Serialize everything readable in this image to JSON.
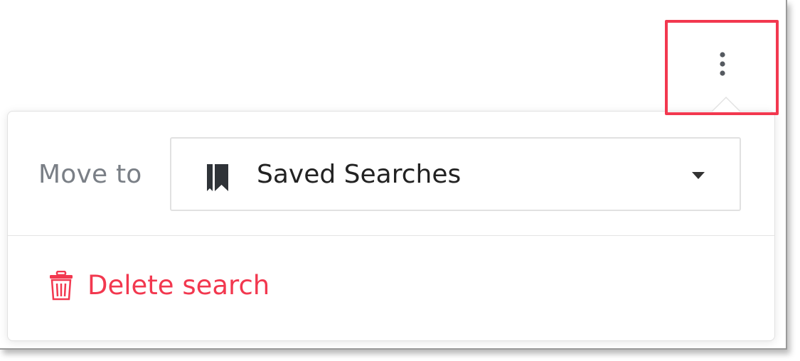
{
  "header": {
    "more_button_icon": "vertical-ellipsis-icon",
    "highlight_color": "#f2384f"
  },
  "menu": {
    "move_to_label": "Move to",
    "folder_select": {
      "icon": "bookmark-icon",
      "value": "Saved Searches",
      "arrow_icon": "caret-down-icon"
    },
    "delete": {
      "icon": "trash-icon",
      "label": "Delete search",
      "color": "#f2384f"
    }
  }
}
